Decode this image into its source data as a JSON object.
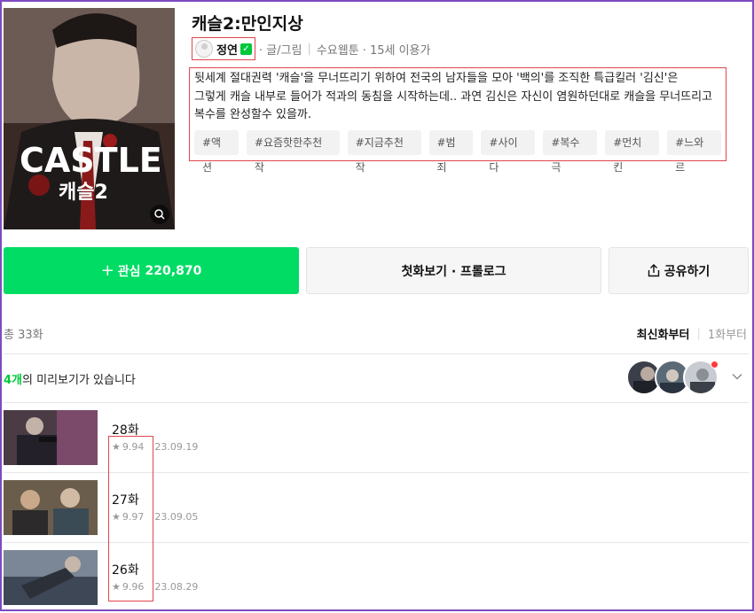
{
  "title": "캐슬2:만인지상",
  "author": {
    "name": "정연",
    "role": "· 글/그림"
  },
  "meta": {
    "day": "수요웹툰",
    "age": "· 15세 이용가"
  },
  "cover": {
    "brand": "CASTLE",
    "sub": "캐슬2"
  },
  "description": "뒷세계 절대권력 '캐슬'을 무너뜨리기 위하여 전국의 남자들을 모아 '백의'를 조직한 특급킬러 '김신'은\n그렇게 캐슬 내부로 들어가 적과의 동침을 시작하는데.. 과연 김신은 자신이 염원하던대로 캐슬을 무너뜨리고\n복수를 완성할수 있을까.",
  "tags": [
    "#액션",
    "#요즘핫한추천작",
    "#지금추천작",
    "#범죄",
    "#사이다",
    "#복수극",
    "#먼치킨",
    "#느와르"
  ],
  "buttons": {
    "favorite": "관심",
    "favorite_count": "220,870",
    "first_episode": "첫화보기 · 프롤로그",
    "share": "공유하기"
  },
  "list": {
    "total": "총 33화",
    "sort_latest": "최신화부터",
    "sort_first": "1화부터"
  },
  "preview": {
    "count": "4개",
    "text": "의 미리보기가 있습니다"
  },
  "episodes": [
    {
      "title": "28화",
      "rating": "9.94",
      "date": "23.09.19"
    },
    {
      "title": "27화",
      "rating": "9.97",
      "date": "23.09.05"
    },
    {
      "title": "26화",
      "rating": "9.96",
      "date": "23.08.29"
    }
  ],
  "colors": {
    "accent": "#00dc64",
    "highlight_box": "#e0474c",
    "frame": "#7d4bc2"
  }
}
